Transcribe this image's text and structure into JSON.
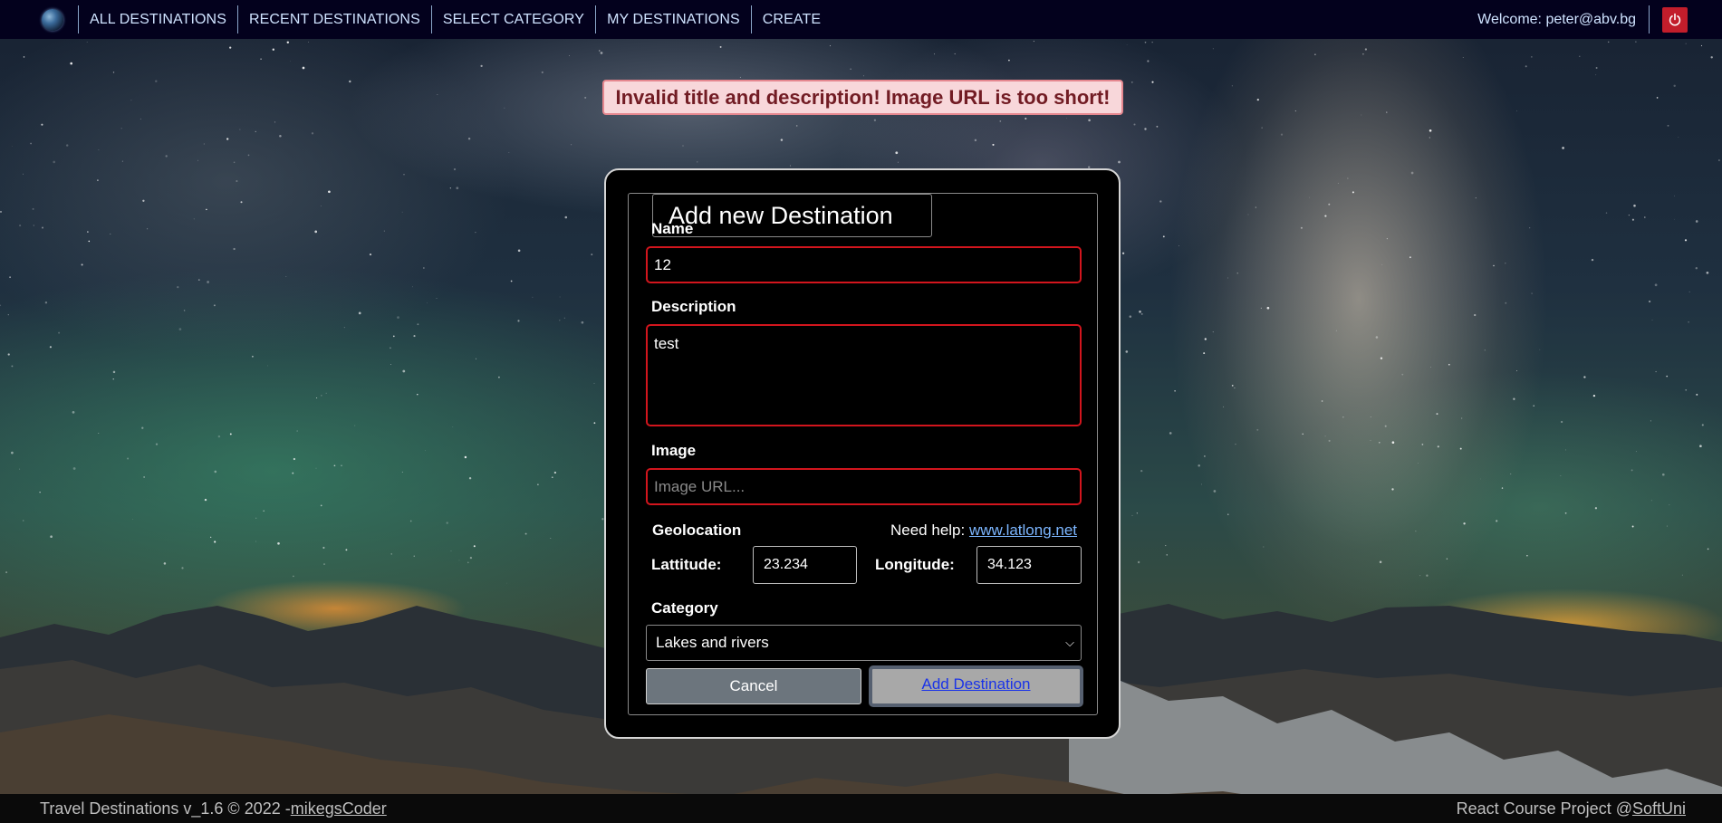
{
  "nav": {
    "links": [
      "ALL DESTINATIONS",
      "RECENT DESTINATIONS",
      "SELECT CATEGORY",
      "MY DESTINATIONS",
      "CREATE"
    ],
    "welcome": "Welcome: peter@abv.bg",
    "logout_icon": "power-icon"
  },
  "error": "Invalid title and description! Image URL is too short!",
  "form": {
    "legend": "Add new Destination",
    "name_label": "Name",
    "name_value": "12",
    "description_label": "Description",
    "description_value": "test",
    "image_label": "Image",
    "image_placeholder": "Image URL...",
    "geolocation_label": "Geolocation",
    "help_text": "Need help: ",
    "help_link": "www.latlong.net",
    "latitude_label": "Lattitude:",
    "latitude_value": "23.234",
    "longitude_label": "Longitude:",
    "longitude_value": "34.123",
    "category_label": "Category",
    "category_value": "Lakes and rivers",
    "cancel_label": "Cancel",
    "submit_label": "Add Destination"
  },
  "footer": {
    "left_text": "Travel Destinations v_1.6 © 2022 -",
    "left_link": "mikegsCoder",
    "right_text": "React Course Project @",
    "right_link": "SoftUni"
  },
  "colors": {
    "nav_bg": "#03011d",
    "error_bg": "#f8d7da",
    "error_text": "#721c24",
    "invalid_border": "#d2151d",
    "logout_bg": "#c21d2b",
    "link": "#7cb6ff"
  }
}
